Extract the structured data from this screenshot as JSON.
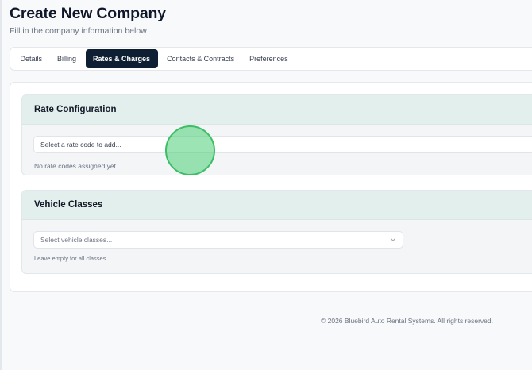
{
  "header": {
    "title": "Create New Company",
    "subtitle": "Fill in the company information below"
  },
  "tabs": [
    {
      "label": "Details",
      "active": false
    },
    {
      "label": "Billing",
      "active": false
    },
    {
      "label": "Rates & Charges",
      "active": true
    },
    {
      "label": "Contacts & Contracts",
      "active": false
    },
    {
      "label": "Preferences",
      "active": false
    }
  ],
  "rate_configuration": {
    "title": "Rate Configuration",
    "select_value": "Select a rate code to add...",
    "empty_note": "No rate codes assigned yet."
  },
  "vehicle_classes": {
    "title": "Vehicle Classes",
    "select_placeholder": "Select vehicle classes...",
    "hint": "Leave empty for all classes"
  },
  "footer": {
    "copyright": "© 2026 Bluebird Auto Rental Systems. All rights reserved."
  },
  "colors": {
    "accent_tab": "#0f1f33",
    "section_header": "#e3efec",
    "cursor_highlight": "#3dbd66"
  },
  "icons": {
    "dropdown": "chevron-down-icon"
  }
}
